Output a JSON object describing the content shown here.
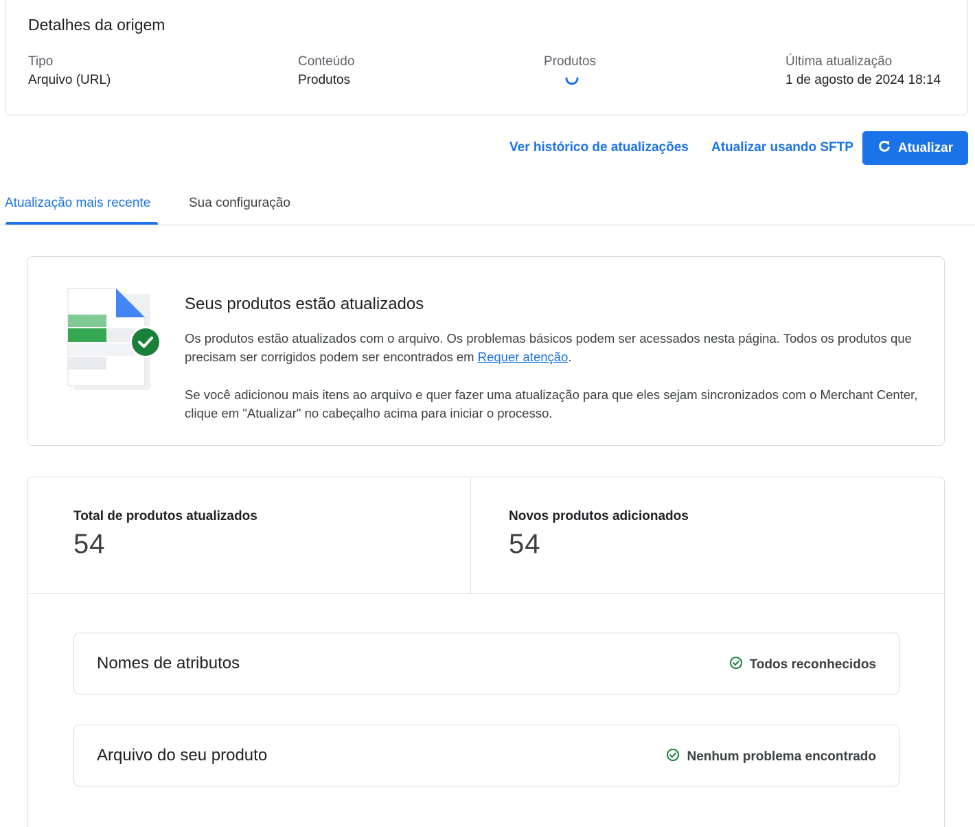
{
  "source": {
    "title": "Detalhes da origem",
    "fields": [
      {
        "label": "Tipo",
        "value": "Arquivo (URL)"
      },
      {
        "label": "Conteúdo",
        "value": "Produtos"
      },
      {
        "label": "Produtos",
        "value": null
      },
      {
        "label": "Última atualização",
        "value": "1 de agosto de 2024 18:14"
      }
    ]
  },
  "actions": {
    "history": "Ver histórico de atualizações",
    "sftp": "Atualizar usando SFTP",
    "refresh": "Atualizar"
  },
  "tabs": [
    {
      "label": "Atualização mais recente",
      "active": true
    },
    {
      "label": "Sua configuração",
      "active": false
    }
  ],
  "status": {
    "title": "Seus produtos estão atualizados",
    "p1_before": "Os produtos estão atualizados com o arquivo. Os problemas básicos podem ser acessados nesta página. Todos os produtos que precisam ser corrigidos podem ser encontrados em ",
    "p1_link": "Requer atenção",
    "p1_after": ".",
    "p2": "Se você adicionou mais itens ao arquivo e quer fazer uma atualização para que eles sejam sincronizados com o Merchant Center, clique em \"Atualizar\" no cabeçalho acima para iniciar o processo."
  },
  "stats": [
    {
      "label": "Total de produtos atualizados",
      "value": "54"
    },
    {
      "label": "Novos produtos adicionados",
      "value": "54"
    }
  ],
  "checks": [
    {
      "title": "Nomes de atributos",
      "status": "Todos reconhecidos"
    },
    {
      "title": "Arquivo do seu produto",
      "status": "Nenhum problema encontrado"
    }
  ],
  "colors": {
    "accent": "#1a73e8",
    "success": "#188038",
    "border": "#dadce0"
  },
  "icons": [
    "loading-spinner-icon",
    "refresh-icon",
    "file-check-illustration",
    "check-circle-icon"
  ]
}
